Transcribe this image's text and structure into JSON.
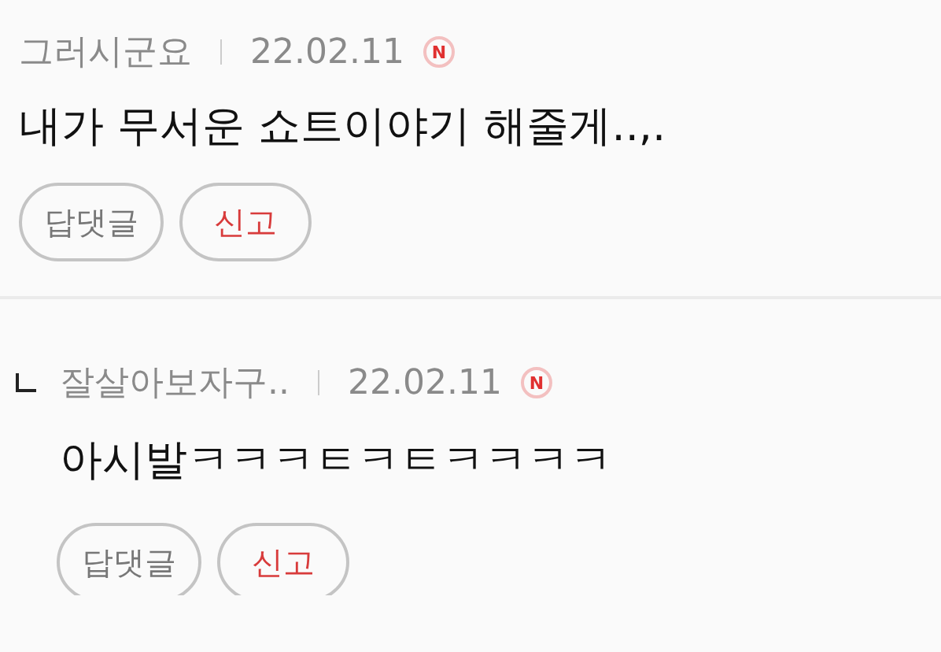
{
  "comments": [
    {
      "kind": "comment",
      "nickname": "그러시군요",
      "date": "22.02.11",
      "badge": "N",
      "text": "내가 무서운 쇼트이야기 해줄게..,.",
      "buttons": [
        {
          "kind": "reply",
          "label": "답댓글"
        },
        {
          "kind": "report",
          "label": "신고"
        }
      ]
    },
    {
      "kind": "reply",
      "nickname": "잘살아보자구..",
      "date": "22.02.11",
      "badge": "N",
      "text": "아시발ㅋㅋㅋㅌㅋㅌㅋㅋㅋㅋ",
      "buttons": [
        {
          "kind": "reply",
          "label": "답댓글"
        },
        {
          "kind": "report",
          "label": "신고"
        }
      ]
    }
  ]
}
